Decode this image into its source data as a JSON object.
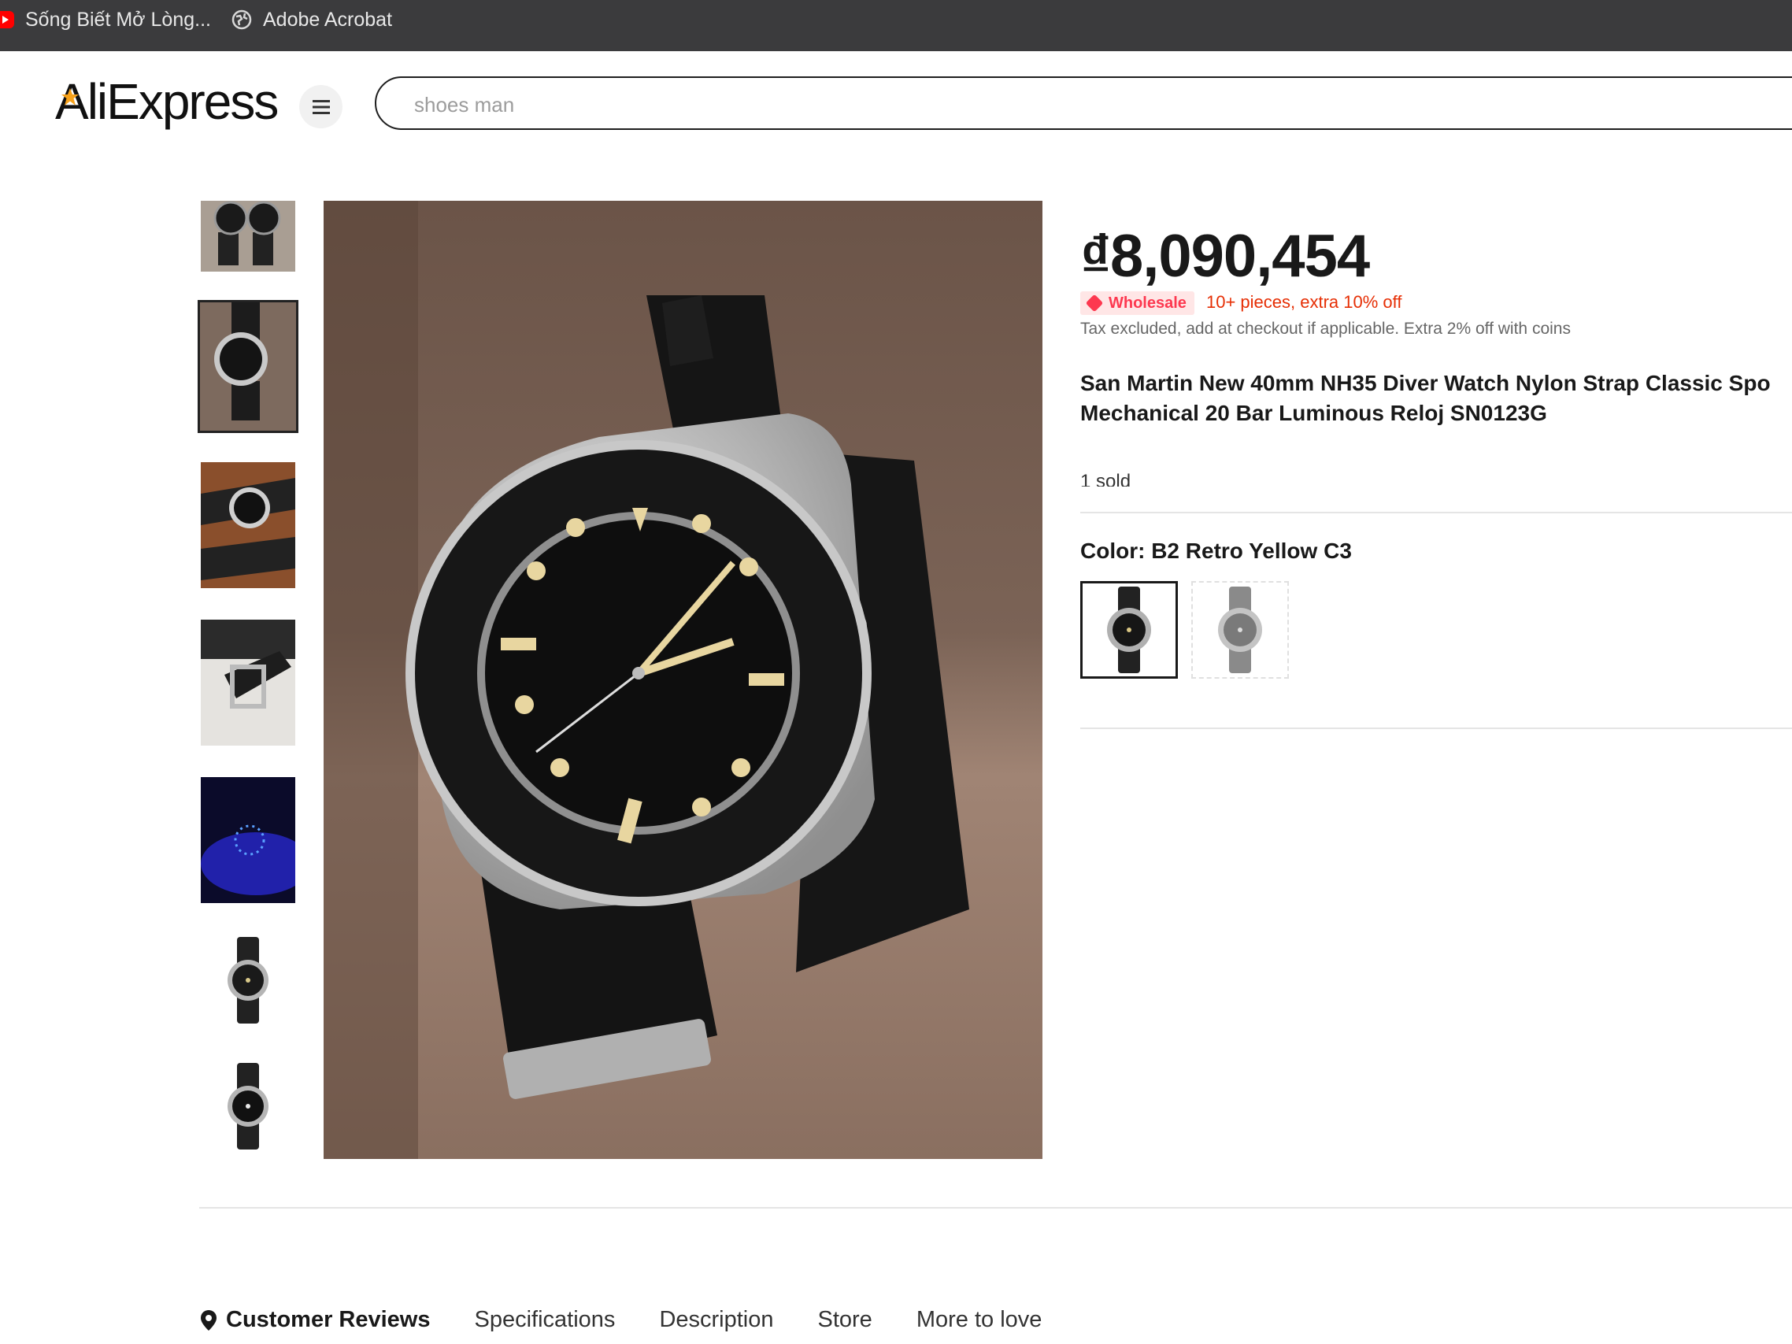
{
  "bookmarks": [
    {
      "label": "Sống Biết Mở Lòng..."
    },
    {
      "label": "Adobe Acrobat"
    }
  ],
  "header": {
    "logo": "AliExpress",
    "search_placeholder": "shoes man"
  },
  "product": {
    "price": "₫8,090,454",
    "wholesale_badge": "Wholesale",
    "wholesale_offer": "10+ pieces, extra 10% off",
    "tax_note": "Tax excluded, add at checkout if applicable. Extra 2% off with coins",
    "title_line1": "San Martin New 40mm NH35 Diver Watch Nylon Strap Classic Spo",
    "title_line2": "Mechanical 20 Bar Luminous Reloj SN0123G",
    "sold": "1 sold",
    "color_label": "Color: B2 Retro Yellow C3"
  },
  "tabs": [
    {
      "label": "Customer Reviews"
    },
    {
      "label": "Specifications"
    },
    {
      "label": "Description"
    },
    {
      "label": "Store"
    },
    {
      "label": "More to love"
    }
  ],
  "colors": {
    "accent_red": "#fd384f",
    "bookmark_bar": "#3b3b3d"
  }
}
